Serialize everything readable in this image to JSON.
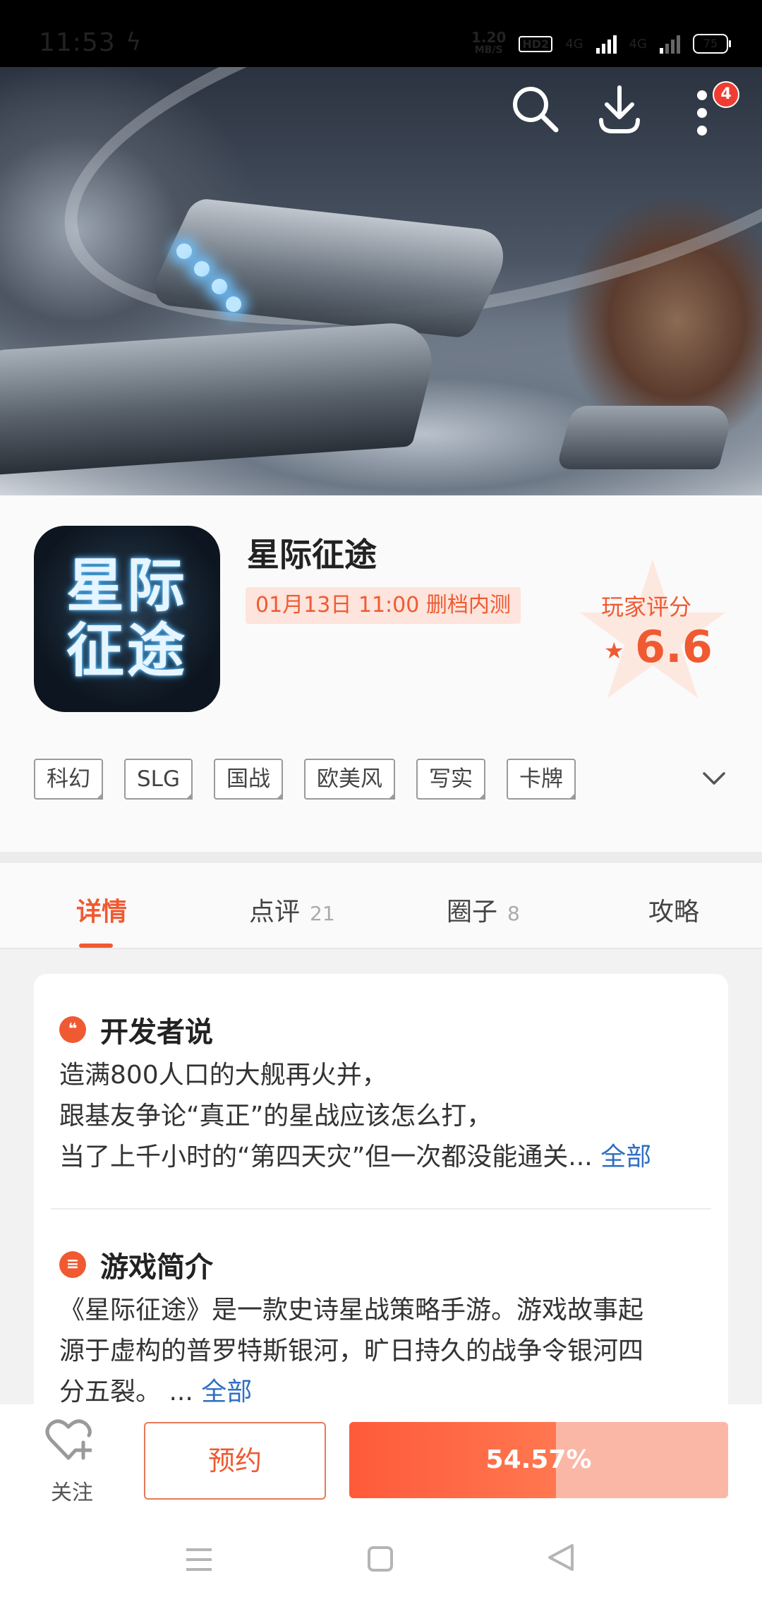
{
  "status_bar": {
    "time": "11:53",
    "speed_value": "1.20",
    "speed_unit": "MB/S",
    "hd": "HD2",
    "net1": "4G",
    "net2": "4G",
    "battery": "75"
  },
  "banner": {
    "notification_count": "4"
  },
  "app": {
    "icon_text_line1": "星际",
    "icon_text_line2": "征途",
    "title": "星际征途",
    "release": "01月13日 11:00 删档内测",
    "rating_label": "玩家评分",
    "rating_value": "6.6",
    "tags": [
      "科幻",
      "SLG",
      "国战",
      "欧美风",
      "写实",
      "卡牌"
    ]
  },
  "tabs": [
    {
      "label": "详情",
      "count": ""
    },
    {
      "label": "点评",
      "count": "21"
    },
    {
      "label": "圈子",
      "count": "8"
    },
    {
      "label": "攻略",
      "count": ""
    }
  ],
  "developer": {
    "icon": "quote-icon",
    "title": "开发者说",
    "lines": [
      "造满800人口的大舰再火并，",
      "跟基友争论“真正”的星战应该怎么打，",
      "当了上千小时的“第四天灾”但一次都没能通关..."
    ],
    "more": "全部"
  },
  "intro": {
    "icon": "document-icon",
    "title": "游戏简介",
    "lines": [
      "《星际征途》是一款史诗星战策略手游。游戏故事起",
      "源于虚构的普罗特斯银河，旷日持久的战争令银河四",
      "分五裂。 ..."
    ],
    "more": "全部"
  },
  "actions": {
    "follow_label": "关注",
    "reserve_label": "预约",
    "progress_text": "54.57%",
    "progress_fraction": 0.5457
  },
  "colors": {
    "accent": "#f05a32",
    "link": "#2f6fc2"
  }
}
